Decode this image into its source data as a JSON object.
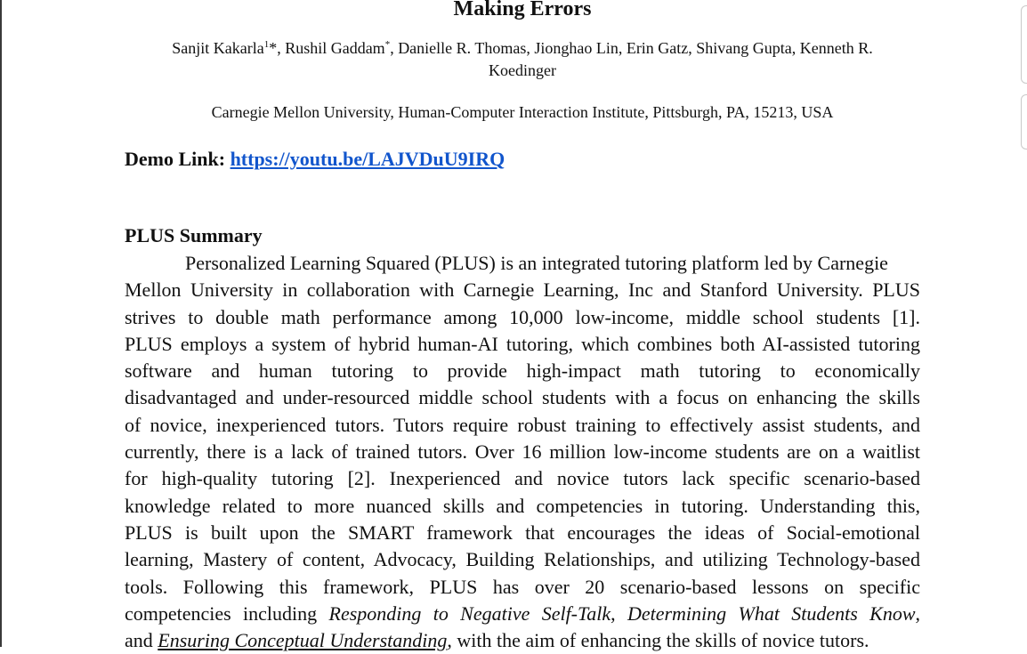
{
  "paper": {
    "title": "Making Errors",
    "authors_line1_pre": "Sanjit Kakarla",
    "authors_line1_sup1": "1",
    "authors_line1_mid": "*, Rushil Gaddam",
    "authors_line1_sup2": "*",
    "authors_line1_post": ", Danielle R. Thomas, Jionghao Lin, Erin Gatz, Shivang Gupta, Kenneth R.",
    "authors_line2": "Koedinger",
    "affiliation": "Carnegie Mellon University, Human-Computer Interaction Institute, Pittsburgh, PA, 15213, USA",
    "demo_label": "Demo Link:",
    "demo_url": "https://youtu.be/LAJVDuU9IRQ"
  },
  "section": {
    "heading": "PLUS Summary",
    "lines": [
      "Personalized Learning Squared (PLUS) is an integrated tutoring platform led by Carnegie",
      "Mellon University in collaboration with Carnegie Learning, Inc and Stanford University. PLUS",
      "strives to double math performance among 10,000 low-income, middle school students [1].",
      "PLUS employs a system of hybrid human-AI tutoring, which combines both AI-assisted tutoring",
      "software and human tutoring to provide high-impact math tutoring to economically",
      "disadvantaged and under-resourced middle school students with a focus on enhancing the skills",
      "of novice, inexperienced tutors. Tutors require robust training to effectively assist students, and",
      "currently, there is a lack of trained tutors. Over 16 million low-income students are on a waitlist",
      "for high-quality tutoring [2]. Inexperienced and novice tutors lack specific scenario-based",
      "knowledge related to more nuanced skills and competencies in tutoring. Understanding this,",
      "PLUS is built upon the SMART framework that encourages the ideas of Social-emotional",
      "learning, Mastery of content, Advocacy, Building Relationships, and utilizing Technology-based",
      "tools. Following this framework, PLUS has over 20 scenario-based lessons on specific"
    ],
    "line14_pre": "competencies including ",
    "line14_em1": "Responding to Negative Self-Talk",
    "line14_sep": ", ",
    "line14_em2": "Determining What Students Know",
    "line14_post": ",",
    "line15_pre": "and ",
    "line15_em": "Ensuring Conceptual Understanding",
    "line15_post": ", with the aim of enhancing the skills of novice tutors."
  },
  "colors": {
    "link": "#1155cc",
    "text": "#111111",
    "left_border": "#3a3a3a"
  }
}
